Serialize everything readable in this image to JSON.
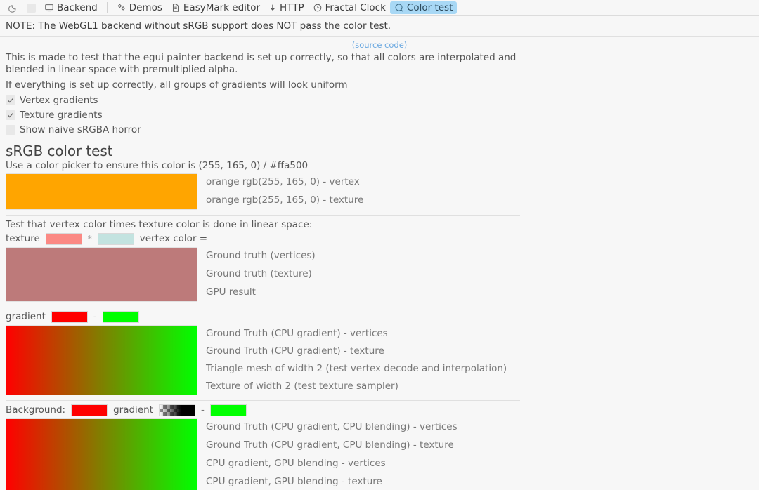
{
  "topbar": {
    "items": [
      {
        "name": "dark-mode-toggle",
        "icon": "moon-icon",
        "label": ""
      },
      {
        "name": "light-mode-toggle",
        "icon": "sun-square-icon",
        "label": ""
      },
      {
        "name": "backend-menu",
        "icon": "monitor-icon",
        "label": "Backend"
      }
    ],
    "tabs": [
      {
        "name": "tab-demos",
        "icon": "shapes-icon",
        "label": "Demos",
        "selected": false
      },
      {
        "name": "tab-easymark-editor",
        "icon": "document-icon",
        "label": "EasyMark editor",
        "selected": false
      },
      {
        "name": "tab-http",
        "icon": "download-arrow-icon",
        "label": "HTTP",
        "selected": false
      },
      {
        "name": "tab-fractal-clock",
        "icon": "clock-icon",
        "label": "Fractal Clock",
        "selected": false
      },
      {
        "name": "tab-color-test",
        "icon": "palette-icon",
        "label": "Color test",
        "selected": true
      }
    ],
    "selected_tab_bg": "#a8d8f5"
  },
  "note": "NOTE: The WebGL1 backend without sRGB support does NOT pass the color test.",
  "source_link": "(source code)",
  "intro": {
    "paragraph1": "This is made to test that the egui painter backend is set up correctly, so that all colors are interpolated and blended in linear space with premultiplied alpha.",
    "paragraph2": "If everything is set up correctly, all groups of gradients will look uniform"
  },
  "checkboxes": [
    {
      "name": "checkbox-vertex-gradients",
      "label": "Vertex gradients",
      "checked": true
    },
    {
      "name": "checkbox-texture-gradients",
      "label": "Texture gradients",
      "checked": true
    },
    {
      "name": "checkbox-naive-srgba-horror",
      "label": "Show naive sRGBA horror",
      "checked": false
    }
  ],
  "srgb_section": {
    "heading": "sRGB color test",
    "instruction": "Use a color picker to ensure this color is (255, 165, 0) / #ffa500",
    "swatch_color": "#ffa500",
    "labels": [
      "orange rgb(255, 165, 0) - vertex",
      "orange rgb(255, 165, 0) - texture"
    ]
  },
  "multiply_section": {
    "description": "Test that vertex color times texture color is done in linear space:",
    "texture_label": "texture",
    "texture_color": "#fb8984",
    "operator": "*",
    "vertex_color": "#c3e3e0",
    "vertex_label": "vertex color =",
    "result_color": "#bd7a7a",
    "labels": [
      "Ground truth (vertices)",
      "Ground truth (texture)",
      "GPU result"
    ]
  },
  "gradient_section": {
    "gradient_label": "gradient",
    "from_color": "#ff0000",
    "to_color": "#00ff00",
    "dash": "-",
    "labels": [
      "Ground Truth (CPU gradient) - vertices",
      "Ground Truth (CPU gradient) - texture",
      "Triangle mesh of width 2 (test vertex decode and interpolation)",
      "Texture of width 2 (test texture sampler)"
    ]
  },
  "background_section": {
    "background_label": "Background:",
    "background_color": "#ff0000",
    "gradient_label": "gradient",
    "alpha_from": "transparent",
    "alpha_to": "#000000",
    "dash": "-",
    "to_color": "#00ff00",
    "labels": [
      "Ground Truth (CPU gradient, CPU blending) - vertices",
      "Ground Truth (CPU gradient, CPU blending) - texture",
      "CPU gradient, GPU blending - vertices",
      "CPU gradient, GPU blending - texture"
    ]
  }
}
